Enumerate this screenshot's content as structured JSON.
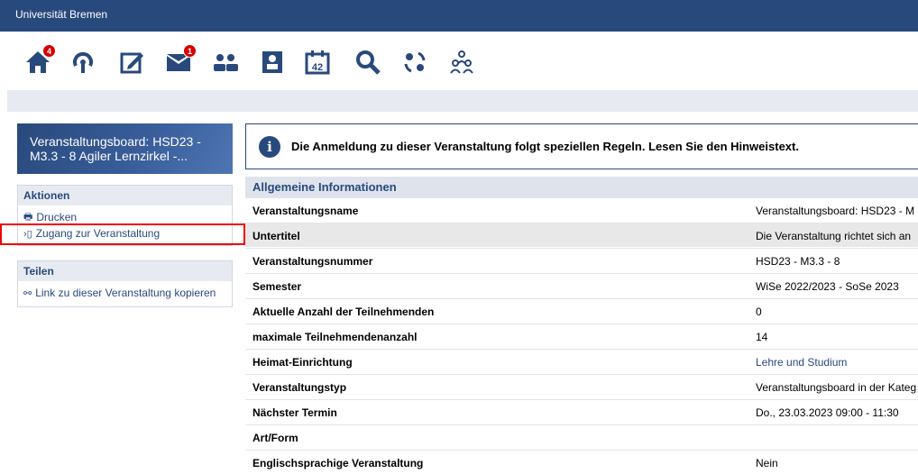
{
  "header": {
    "brand": "Universität Bremen"
  },
  "nav": {
    "icons": [
      {
        "name": "home-icon",
        "badge": "4"
      },
      {
        "name": "activity-icon",
        "badge": ""
      },
      {
        "name": "edit-icon",
        "badge": ""
      },
      {
        "name": "mail-icon",
        "badge": "1"
      },
      {
        "name": "community-icon",
        "badge": ""
      },
      {
        "name": "profile-icon",
        "badge": ""
      },
      {
        "name": "calendar-icon",
        "badge": ""
      },
      {
        "name": "search-icon",
        "badge": ""
      },
      {
        "name": "tools-icon",
        "badge": ""
      },
      {
        "name": "groups-icon",
        "badge": ""
      }
    ],
    "calendar_day": "42"
  },
  "sidebar": {
    "course_title": "Veranstaltungsboard: HSD23 - M3.3 - 8 Agiler Lernzirkel -...",
    "actions": {
      "title": "Aktionen",
      "items": [
        {
          "icon": "print-icon",
          "label": "Drucken"
        },
        {
          "icon": "enter-icon",
          "label": "Zugang zur Veranstaltung"
        }
      ]
    },
    "share": {
      "title": "Teilen",
      "items": [
        {
          "icon": "link-icon",
          "label": "Link zu dieser Veranstaltung kopieren"
        }
      ]
    }
  },
  "main": {
    "notice": "Die Anmeldung zu dieser Veranstaltung folgt speziellen Regeln. Lesen Sie den Hinweistext.",
    "section_title": "Allgemeine Informationen",
    "rows": [
      {
        "key": "Veranstaltungsname",
        "value": "Veranstaltungsboard: HSD23 - M"
      },
      {
        "key": "Untertitel",
        "value": "Die Veranstaltung richtet sich an"
      },
      {
        "key": "Veranstaltungsnummer",
        "value": "HSD23 - M3.3 - 8"
      },
      {
        "key": "Semester",
        "value": "WiSe 2022/2023 - SoSe 2023"
      },
      {
        "key": "Aktuelle Anzahl der Teilnehmenden",
        "value": "0"
      },
      {
        "key": "maximale Teilnehmendenanzahl",
        "value": "14"
      },
      {
        "key": "Heimat-Einrichtung",
        "value": "Lehre und Studium"
      },
      {
        "key": "Veranstaltungstyp",
        "value": "Veranstaltungsboard in der Kateg"
      },
      {
        "key": "Nächster Termin",
        "value": "Do., 23.03.2023 09:00 - 11:30"
      },
      {
        "key": "Art/Form",
        "value": ""
      },
      {
        "key": "Englischsprachige Veranstaltung",
        "value": "Nein"
      }
    ]
  },
  "colors": {
    "brand": "#28497c",
    "badge": "#d60000",
    "highlight": "#e00000"
  }
}
